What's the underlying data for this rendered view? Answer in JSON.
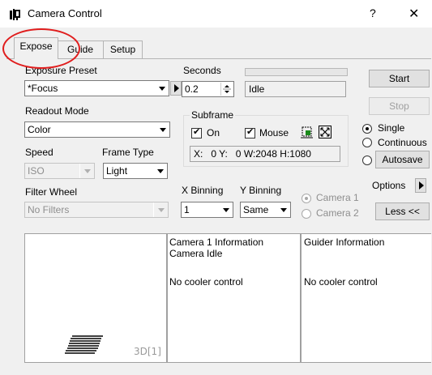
{
  "window": {
    "title": "Camera Control",
    "help": "?",
    "close": "✕"
  },
  "tabs": [
    {
      "label": "Expose",
      "active": true
    },
    {
      "label": "Guide",
      "active": false
    },
    {
      "label": "Setup",
      "active": false
    }
  ],
  "exposure_preset": {
    "label": "Exposure Preset",
    "value": "*Focus"
  },
  "seconds": {
    "label": "Seconds",
    "value": "0.2",
    "status": "Idle"
  },
  "readout_mode": {
    "label": "Readout Mode",
    "value": "Color"
  },
  "speed": {
    "label": "Speed",
    "value": "ISO"
  },
  "frame_type": {
    "label": "Frame Type",
    "value": "Light"
  },
  "filter_wheel": {
    "label": "Filter Wheel",
    "value": "No Filters"
  },
  "subframe": {
    "label": "Subframe",
    "on_label": "On",
    "on_checked": true,
    "mouse_label": "Mouse",
    "mouse_checked": true,
    "coords": "X:   0 Y:   0 W:2048 H:1080"
  },
  "binning": {
    "x_label": "X Binning",
    "x_value": "1",
    "y_label": "Y Binning",
    "y_value": "Same"
  },
  "camera_select": {
    "camera1": "Camera 1",
    "camera2": "Camera 2"
  },
  "buttons": {
    "start": "Start",
    "stop": "Stop",
    "options": "Options",
    "less": "Less <<"
  },
  "mode": {
    "single": "Single",
    "continuous": "Continuous",
    "autosave": "Autosave",
    "selected": "single"
  },
  "preview": {
    "label": "3D[1]"
  },
  "camera1_info": {
    "title": "Camera 1 Information",
    "status": "Camera Idle",
    "cooler": "No cooler control"
  },
  "guider_info": {
    "title": "Guider Information",
    "cooler": "No cooler control"
  },
  "colors": {
    "highlight_oval": "#e01d1d",
    "panel_bg": "#ffffff",
    "window_bg": "#f0f0f0"
  }
}
